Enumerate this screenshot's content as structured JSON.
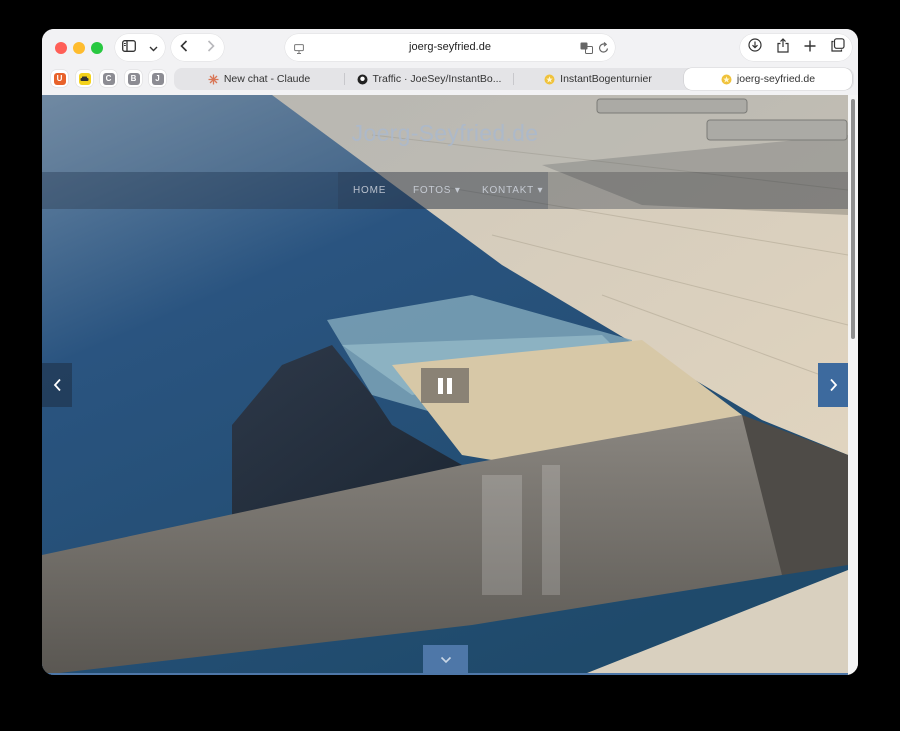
{
  "browser": {
    "address": "joerg-seyfried.de",
    "favorites": [
      {
        "letter": "U",
        "color": "#e8622a"
      },
      {
        "letter": "",
        "color": "#f3d21c"
      },
      {
        "letter": "C",
        "color": "#8c8c93"
      },
      {
        "letter": "B",
        "color": "#8c8c93"
      },
      {
        "letter": "J",
        "color": "#8c8c93"
      }
    ],
    "tabs": [
      {
        "label": "New chat - Claude",
        "icon": "claude-icon"
      },
      {
        "label": "Traffic · JoeSey/InstantBo...",
        "icon": "github-icon"
      },
      {
        "label": "InstantBogenturnier",
        "icon": "site-star-icon"
      },
      {
        "label": "joerg-seyfried.de",
        "icon": "site-star-icon",
        "active": true
      }
    ]
  },
  "site": {
    "title": "Joerg-Seyfried.de",
    "menu": [
      "HOME",
      "FOTOS ▾",
      "KONTAKT ▾"
    ]
  },
  "colors": {
    "accent_blue": "#3d6a9e",
    "window_bg": "#f2f2f4"
  }
}
